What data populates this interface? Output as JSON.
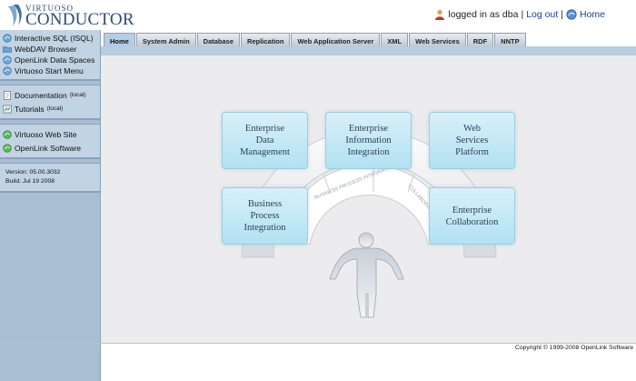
{
  "header": {
    "logo_top": "VIRTUOSO",
    "logo_main": "CONDUCTOR",
    "logged_in_text": "logged in as dba",
    "separator": "|",
    "logout_label": "Log out",
    "home_label": "Home"
  },
  "sidebar": {
    "tools": [
      {
        "label": "Interactive SQL (ISQL)",
        "icon": "globe-icon"
      },
      {
        "label": "WebDAV Browser",
        "icon": "folder-icon"
      },
      {
        "label": "OpenLink Data Spaces",
        "icon": "globe-icon"
      },
      {
        "label": "Virtuoso Start Menu",
        "icon": "globe-icon"
      }
    ],
    "docs": [
      {
        "label": "Documentation",
        "suffix": "(local)",
        "icon": "document-icon"
      },
      {
        "label": "Tutorials",
        "suffix": "(local)",
        "icon": "tutorial-icon"
      }
    ],
    "sites": [
      {
        "label": "Virtuoso Web Site",
        "icon": "globe-icon"
      },
      {
        "label": "OpenLink Software",
        "icon": "globe-icon"
      }
    ],
    "version": "Version: 05.00.3032",
    "build": "Build: Jul 19 2008"
  },
  "tabs": [
    {
      "label": "Home",
      "active": true
    },
    {
      "label": "System Admin",
      "active": false
    },
    {
      "label": "Database",
      "active": false
    },
    {
      "label": "Replication",
      "active": false
    },
    {
      "label": "Web Application Server",
      "active": false
    },
    {
      "label": "XML",
      "active": false
    },
    {
      "label": "Web Services",
      "active": false
    },
    {
      "label": "RDF",
      "active": false
    },
    {
      "label": "NNTP",
      "active": false
    }
  ],
  "main": {
    "boxes": [
      {
        "label": "Enterprise\nData\nManagement"
      },
      {
        "label": "Enterprise\nInformation\nIntegration"
      },
      {
        "label": "Web\nServices\nPlatform"
      },
      {
        "label": "Business\nProcess\nIntegration"
      },
      {
        "label": "Enterprise\nCollaboration"
      }
    ],
    "arc_labels": [
      "BUSINESS PROCESS INTEGRATION",
      "COLLABORATION"
    ]
  },
  "footer": {
    "copyright": "Copyright © 1999-2008 OpenLink Software"
  },
  "colors": {
    "sidebar_bg": "#a9bed2",
    "box_bg": "#c2e7f5",
    "link": "#1a3da8",
    "logo": "#2d4d78"
  }
}
